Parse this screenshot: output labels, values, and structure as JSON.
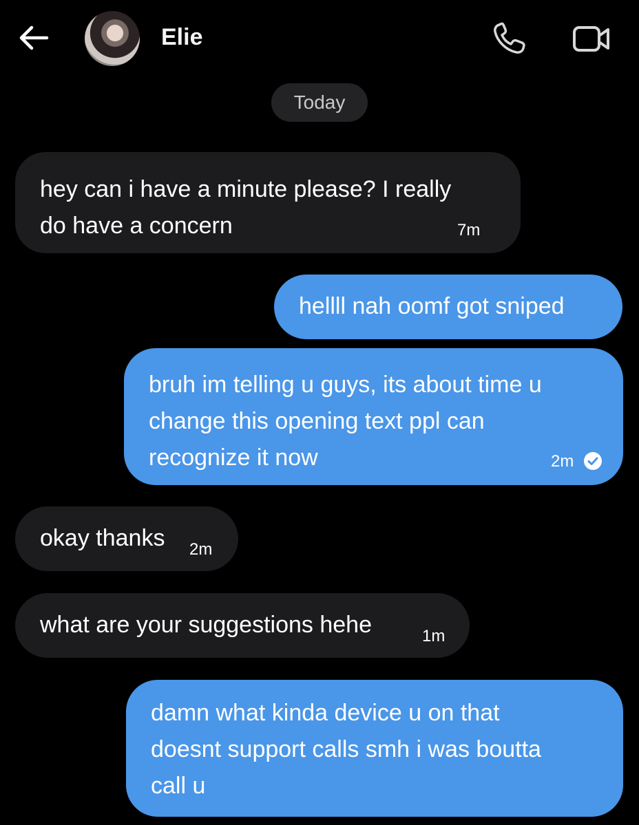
{
  "header": {
    "contact_name": "Elie",
    "back_icon": "arrow-left-icon",
    "call_icon": "phone-icon",
    "video_icon": "video-camera-icon"
  },
  "date_divider": "Today",
  "colors": {
    "background": "#000000",
    "incoming_bubble": "#1c1c1e",
    "outgoing_bubble": "#4a96e8",
    "date_pill": "#232325"
  },
  "messages": [
    {
      "direction": "incoming",
      "text": "hey can i have a minute please? I really\ndo have a concern",
      "time": "7m"
    },
    {
      "direction": "outgoing",
      "text": "hellll nah oomf got sniped",
      "time": ""
    },
    {
      "direction": "outgoing",
      "text": "bruh im telling u guys, its about time u\nchange this opening text ppl can\nrecognize it now",
      "time": "2m",
      "status": "read-checkmark-icon"
    },
    {
      "direction": "incoming",
      "text": "okay thanks",
      "time": "2m"
    },
    {
      "direction": "incoming",
      "text": "what are your suggestions hehe",
      "time": "1m"
    },
    {
      "direction": "outgoing",
      "text": "damn what kinda device u on that\ndoesnt support calls smh i was boutta\ncall u",
      "time": ""
    }
  ]
}
